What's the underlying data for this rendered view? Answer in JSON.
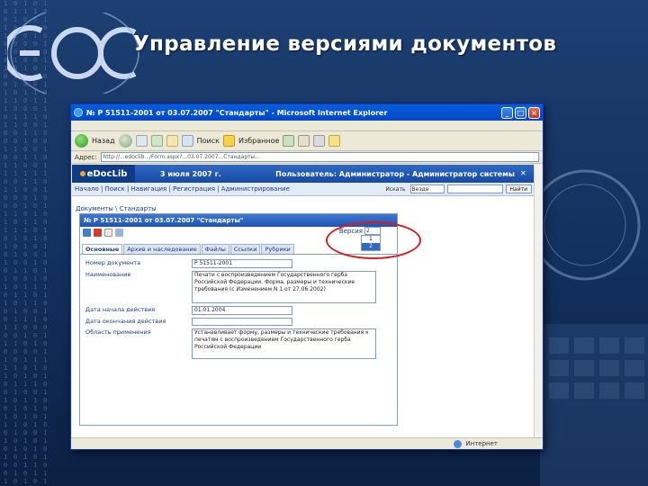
{
  "slide": {
    "title": "Управление версиями документов"
  },
  "window": {
    "title": "№ Р 51511-2001 от 03.07.2007 \"Стандарты\" - Microsoft Internet Explorer",
    "toolbar": {
      "back_label": "Назад",
      "search_label": "Поиск",
      "favorites_label": "Избранное"
    },
    "address": {
      "label": "Адрес:",
      "url": "http://...edoclib.../Form.aspx?...03.07.2007...Стандарты..."
    },
    "status": {
      "zone": "Интернет"
    }
  },
  "app": {
    "logo": "eDocLib",
    "date": "3 июля 2007 г.",
    "user": "Пользователь: Администратор - Администратор системы",
    "nav": {
      "links": "Начало | Поиск | Навигация | Регистрация | Администрирование",
      "search_label": "Искать",
      "search_scope": "Везде",
      "go_button": "Найти"
    },
    "breadcrumb": "Документы \\ Стандарты",
    "document": {
      "title": "№ Р 51511-2001 от 03.07.2007 \"Стандарты\"",
      "version_label": "Версия",
      "version_selected": "2",
      "version_options": [
        "1",
        "2"
      ],
      "tabs": [
        "Основные",
        "Архив и наследование",
        "Файлы",
        "Ссылки",
        "Рубрики"
      ],
      "fields": [
        {
          "label": "Номер документа",
          "value": "Р 51511-2001"
        },
        {
          "label": "Наименование",
          "value": "Печати с воспроизведением Государственного герба Российской Федерации. Форма, размеры и технические требования (с Изменением N 1 от 27.06.2002)"
        },
        {
          "label": "Дата начала действия",
          "value": "01.01.2004"
        },
        {
          "label": "Дата окончания действия",
          "value": ""
        },
        {
          "label": "Область применения",
          "value": "Устанавливает форму, размеры и технические требования к печатям с воспроизведением Государственного герба Российской Федерации"
        }
      ]
    }
  },
  "colors": {
    "slide_bg": "#1d3f72",
    "title_bar": "#0453d4",
    "app_header": "#2f69c6",
    "annotation": "#d81e1e"
  }
}
